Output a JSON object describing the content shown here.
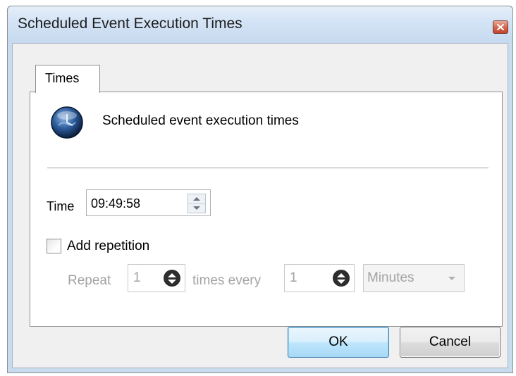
{
  "window": {
    "title": "Scheduled Event Execution Times"
  },
  "tabs": [
    {
      "label": "Times",
      "selected": true
    }
  ],
  "header": {
    "icon": "globe-clock-icon",
    "text": "Scheduled event execution times"
  },
  "time": {
    "label": "Time",
    "value": "09:49:58"
  },
  "repetition": {
    "checkbox_label": "Add repetition",
    "checked": false,
    "repeat_label": "Repeat",
    "repeat_count": "1",
    "times_every_label": "times every",
    "interval": "1",
    "unit": "Minutes"
  },
  "buttons": {
    "ok": "OK",
    "cancel": "Cancel"
  },
  "colors": {
    "titlebar": "#d3e3f5",
    "close_button": "#c2432b",
    "ok_button_border": "#3c7fb1",
    "disabled_text": "#a3a3a3"
  }
}
